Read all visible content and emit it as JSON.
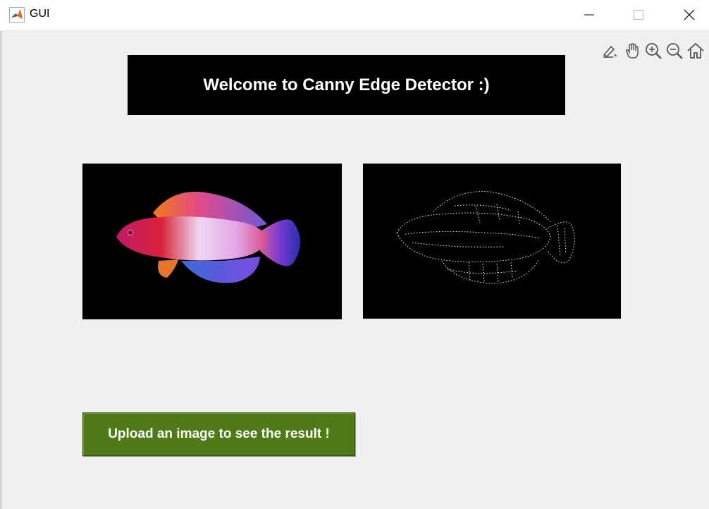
{
  "window": {
    "title": "GUI",
    "app_icon": "matlab-logo-icon",
    "controls": [
      "minimize-icon",
      "maximize-icon",
      "close-icon"
    ]
  },
  "axes_toolbar": {
    "tools": [
      "brush-icon",
      "pan-hand-icon",
      "zoom-in-icon",
      "zoom-out-icon",
      "home-icon"
    ]
  },
  "banner": {
    "text": "Welcome to Canny Edge Detector :)"
  },
  "images": {
    "original": "original-fish-image",
    "result": "canny-edge-result-image"
  },
  "upload_button": {
    "label": "Upload an image to see the result !"
  },
  "colors": {
    "background": "#f0f0f0",
    "banner_bg": "#000000",
    "button_bg": "#4e7b17",
    "button_text": "#ffffff"
  }
}
